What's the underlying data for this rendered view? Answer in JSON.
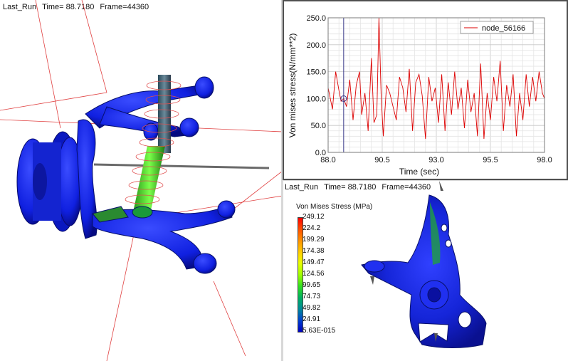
{
  "views": {
    "model": {
      "run": "Last_Run",
      "time": "Time= 88.7180",
      "frame": "Frame=44360"
    },
    "fea": {
      "run": "Last_Run",
      "time": "Time= 88.7180",
      "frame": "Frame=44360",
      "legend_title": "Von Mises Stress (MPa)",
      "legend_values": [
        "249.12",
        "224.2",
        "199.29",
        "174.38",
        "149.47",
        "124.56",
        "99.65",
        "74.73",
        "49.82",
        "24.91",
        "5.63E-015"
      ]
    }
  },
  "chart_data": {
    "type": "line",
    "title": "",
    "xlabel": "Time (sec)",
    "ylabel": "Von mises stress(N/mm**2)",
    "xlim": [
      88.0,
      98.0
    ],
    "ylim": [
      0.0,
      250.0
    ],
    "xticks": [
      "88.0",
      "90.5",
      "93.0",
      "95.5",
      "98.0"
    ],
    "yticks": [
      "0.0",
      "50.0",
      "100.0",
      "150.0",
      "200.0",
      "250.0"
    ],
    "grid": true,
    "legend_position": "top-right",
    "cursor_time": 88.718,
    "colors": {
      "series": "#dd0000",
      "cursor": "#3a3a8a"
    },
    "series": [
      {
        "name": "node_56166",
        "x": [
          88.0,
          88.2,
          88.35,
          88.5,
          88.6,
          88.72,
          88.85,
          89.0,
          89.15,
          89.3,
          89.45,
          89.55,
          89.7,
          89.85,
          90.0,
          90.12,
          90.25,
          90.35,
          90.45,
          90.55,
          90.7,
          90.85,
          91.0,
          91.15,
          91.3,
          91.45,
          91.6,
          91.75,
          91.9,
          92.05,
          92.2,
          92.35,
          92.5,
          92.65,
          92.8,
          92.95,
          93.1,
          93.25,
          93.4,
          93.55,
          93.7,
          93.85,
          94.0,
          94.15,
          94.3,
          94.45,
          94.6,
          94.75,
          94.9,
          95.05,
          95.2,
          95.35,
          95.5,
          95.65,
          95.8,
          95.95,
          96.1,
          96.25,
          96.4,
          96.55,
          96.7,
          96.85,
          97.0,
          97.15,
          97.3,
          97.45,
          97.6,
          97.75,
          97.9,
          98.0
        ],
        "y": [
          120,
          80,
          150,
          115,
          95,
          100,
          85,
          135,
          60,
          125,
          150,
          70,
          110,
          40,
          175,
          55,
          70,
          250,
          105,
          30,
          125,
          110,
          85,
          60,
          140,
          120,
          75,
          155,
          40,
          130,
          145,
          105,
          25,
          140,
          95,
          120,
          55,
          145,
          40,
          130,
          70,
          150,
          80,
          120,
          45,
          135,
          75,
          110,
          30,
          165,
          25,
          110,
          60,
          140,
          95,
          170,
          40,
          125,
          85,
          145,
          30,
          110,
          60,
          145,
          85,
          140,
          95,
          150,
          110,
          100
        ]
      }
    ]
  }
}
